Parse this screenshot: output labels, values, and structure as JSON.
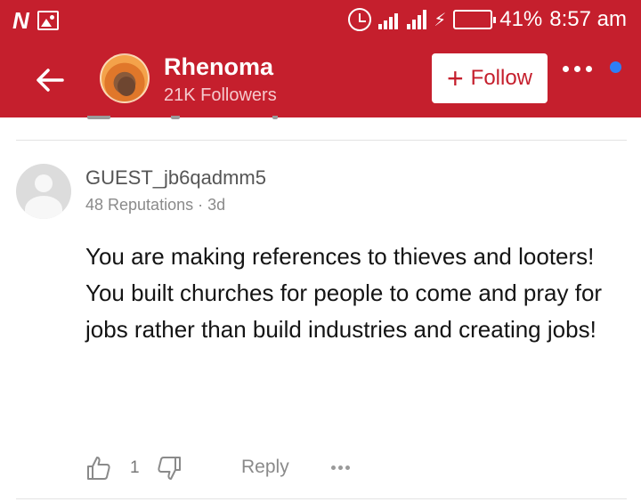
{
  "status_bar": {
    "left_icons": [
      "news-app-icon",
      "image-icon"
    ],
    "app_letter": "N",
    "right_icons": [
      "alarm-icon",
      "signal-icon",
      "charging-icon",
      "battery-icon"
    ],
    "battery_percent": "41%",
    "time": "8:57 am",
    "battery_level": 0.41,
    "battery_color": "#33c24d"
  },
  "header": {
    "background": "#c51f2d",
    "back_icon": "arrow-left-icon",
    "profile": {
      "name": "Rhenoma",
      "followers": "21K Followers"
    },
    "follow_button": {
      "icon": "plus-icon",
      "plus": "+",
      "label": "Follow"
    },
    "more_icon": "more-horizontal-icon",
    "notification_dot_color": "#2f7ef5"
  },
  "comment": {
    "username": "GUEST_jb6qadmm5",
    "meta": "48 Reputations · 3d",
    "text": "You are making references to thieves and looters!\nYou built churches for people to come and pray for jobs rather than build industries and creating jobs!",
    "actions": {
      "like_icon": "thumbs-up-icon",
      "like_count": "1",
      "dislike_icon": "thumbs-down-icon",
      "reply_label": "Reply",
      "more_icon": "more-horizontal-icon"
    }
  }
}
